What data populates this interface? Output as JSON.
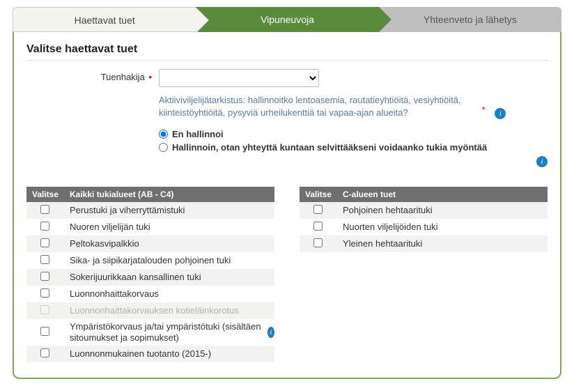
{
  "wizard": {
    "step1": "Haettavat tuet",
    "step2": "Vipuneuvoja",
    "step3": "Yhteenveto ja lähetys"
  },
  "panel": {
    "title": "Valitse haettavat tuet",
    "applicant_label": "Tuenhakija",
    "applicant_value": "",
    "question": "Aktiiviviljelijätarkistus: hallinnoitko lentoasemia, rautatieyhtiöitä, vesiyhtiöitä, kiinteistöyhtiöitä, pysyviä urheilukenttiä tai vapaa-ajan alueita?",
    "radio1": "En hallinnoi",
    "radio2": "Hallinnoin, otan yhteyttä kuntaan selvittääkseni voidaanko tukia myöntää"
  },
  "tables": {
    "select_header": "Valitse",
    "left_title": "Kaikki tukialueet (AB - C4)",
    "right_title": "C-alueen tuet",
    "left": [
      {
        "label": "Perustuki ja viherryttämistuki",
        "disabled": false,
        "info": false
      },
      {
        "label": "Nuoren viljelijän tuki",
        "disabled": false,
        "info": false
      },
      {
        "label": "Peltokasvipalkkio",
        "disabled": false,
        "info": false
      },
      {
        "label": "Sika- ja siipikarjatalouden pohjoinen tuki",
        "disabled": false,
        "info": false
      },
      {
        "label": "Sokerijuurikkaan kansallinen tuki",
        "disabled": false,
        "info": false
      },
      {
        "label": "Luonnonhaittakorvaus",
        "disabled": false,
        "info": false
      },
      {
        "label": "Luonnonhaittakorvauksen kotieläinkorotus",
        "disabled": true,
        "info": false
      },
      {
        "label": "Ympäristökorvaus ja/tai ympäristötuki (sisältäen sitoumukset ja sopimukset)",
        "disabled": false,
        "info": true,
        "tall": true
      },
      {
        "label": "Luonnonmukainen tuotanto (2015-)",
        "disabled": false,
        "info": false
      }
    ],
    "right": [
      {
        "label": "Pohjoinen hehtaarituki"
      },
      {
        "label": "Nuorten viljelijöiden tuki"
      },
      {
        "label": "Yleinen hehtaarituki"
      }
    ]
  }
}
